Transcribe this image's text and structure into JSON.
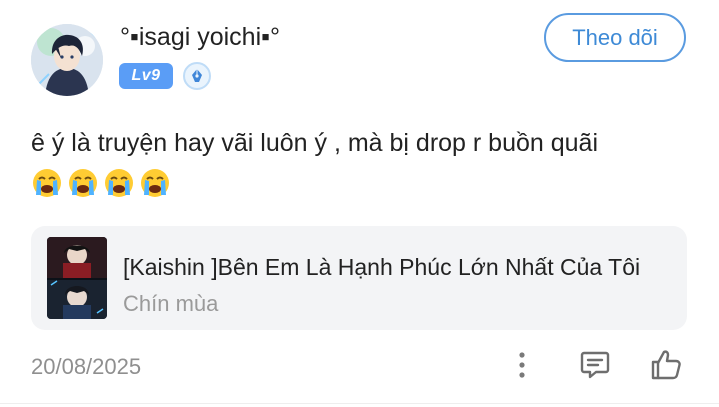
{
  "user": {
    "name": "°▪isagi yoichi▪°",
    "level": "Lv9",
    "pen_badge_icon": "pen-nib-icon"
  },
  "follow_button": {
    "label": "Theo dõi"
  },
  "post": {
    "text": "ê ý là truyện hay vãi luôn ý , mà bị drop r buồn quãi",
    "emojis": [
      "loudly-crying-face",
      "loudly-crying-face",
      "loudly-crying-face",
      "loudly-crying-face"
    ]
  },
  "story": {
    "title": "[Kaishin ]Bên Em Là Hạnh Phúc Lớn Nhất Của Tôi",
    "author": "Chín mùa"
  },
  "footer": {
    "date": "20/08/2025",
    "icons": [
      "more-vertical-icon",
      "comment-icon",
      "like-icon"
    ]
  },
  "colors": {
    "accent": "#5a9be0",
    "level_badge": "#5a9df6",
    "card_bg": "#f3f4f6",
    "muted_text": "#8f8f8f"
  }
}
